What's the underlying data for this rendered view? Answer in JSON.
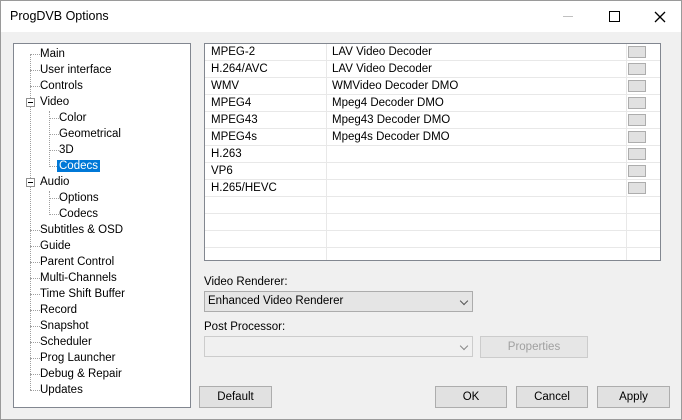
{
  "window": {
    "title": "ProgDVB Options"
  },
  "tree": {
    "items": [
      {
        "label": "Main"
      },
      {
        "label": "User interface"
      },
      {
        "label": "Controls"
      },
      {
        "label": "Video"
      },
      {
        "label": "Color"
      },
      {
        "label": "Geometrical"
      },
      {
        "label": "3D"
      },
      {
        "label": "Codecs",
        "selected": true
      },
      {
        "label": "Audio"
      },
      {
        "label": "Options"
      },
      {
        "label": "Codecs"
      },
      {
        "label": "Subtitles & OSD"
      },
      {
        "label": "Guide"
      },
      {
        "label": "Parent Control"
      },
      {
        "label": "Multi-Channels"
      },
      {
        "label": "Time Shift Buffer"
      },
      {
        "label": "Record"
      },
      {
        "label": "Snapshot"
      },
      {
        "label": "Scheduler"
      },
      {
        "label": "Prog Launcher"
      },
      {
        "label": "Debug & Repair"
      },
      {
        "label": "Updates"
      }
    ]
  },
  "codecs": {
    "rows": [
      {
        "format": "MPEG-2",
        "decoder": "LAV Video Decoder"
      },
      {
        "format": "H.264/AVC",
        "decoder": "LAV Video Decoder"
      },
      {
        "format": "WMV",
        "decoder": "WMVideo Decoder DMO"
      },
      {
        "format": "MPEG4",
        "decoder": "Mpeg4 Decoder DMO"
      },
      {
        "format": "MPEG43",
        "decoder": "Mpeg43 Decoder DMO"
      },
      {
        "format": "MPEG4s",
        "decoder": "Mpeg4s Decoder DMO"
      },
      {
        "format": "H.263",
        "decoder": ""
      },
      {
        "format": "VP6",
        "decoder": ""
      },
      {
        "format": "H.265/HEVC",
        "decoder": ""
      },
      {
        "format": "",
        "decoder": ""
      },
      {
        "format": "",
        "decoder": ""
      },
      {
        "format": "",
        "decoder": ""
      }
    ]
  },
  "video_renderer": {
    "label": "Video Renderer:",
    "value": "Enhanced Video Renderer"
  },
  "post_processor": {
    "label": "Post Processor:",
    "value": "",
    "properties_label": "Properties"
  },
  "buttons": {
    "default": "Default",
    "ok": "OK",
    "cancel": "Cancel",
    "apply": "Apply"
  }
}
